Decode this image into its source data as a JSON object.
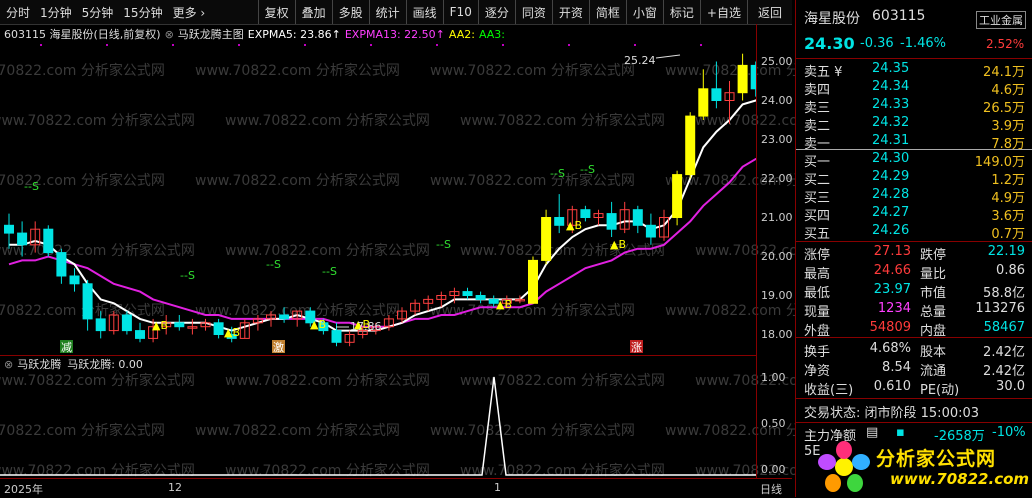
{
  "toolbar": {
    "left": [
      "分时",
      "1分钟",
      "5分钟",
      "15分钟",
      "更多 ›"
    ],
    "right": [
      "复权",
      "叠加",
      "多股",
      "统计",
      "画线",
      "F10",
      "逐分",
      "同资",
      "开资",
      "简框",
      "小窗",
      "标记",
      "+自选",
      "返回"
    ]
  },
  "info": {
    "code_name": "603115 海星股份(日线,前复权)",
    "indicator": "马跃龙腾主图",
    "expma5": "EXPMA5: 23.86↑",
    "expma13": "EXPMA13: 22.50↑",
    "aa2": "AA2:",
    "aa3": "AA3:"
  },
  "y_axis": [
    "25.00",
    "24.00",
    "23.00",
    "22.00",
    "21.00",
    "20.00",
    "19.00",
    "18.00"
  ],
  "sub_y_axis": [
    "1.00",
    "0.50",
    "0.00"
  ],
  "sub_indicator": {
    "name": "马跃龙腾",
    "value": "马跃龙腾: 0.00"
  },
  "x_axis": {
    "year": "2025年",
    "m12": "12",
    "m1": "1",
    "period": "日线"
  },
  "chart_labels": {
    "high": "25.24",
    "low": "17.86",
    "b": "▲B",
    "s": "--S",
    "tag_jian": "减",
    "tag_ji": "激",
    "tag_zhang": "涨"
  },
  "watermark": "www.70822.com 分析家公式网",
  "panel": {
    "name": "海星股份",
    "code": "603115",
    "sector": "工业金属",
    "price": "24.30",
    "change": "-0.36",
    "change_pct": "-1.46%",
    "sector_pct": "2.52%",
    "asks": [
      {
        "label": "卖五 ¥",
        "price": "24.35",
        "vol": "24.1万"
      },
      {
        "label": "卖四",
        "price": "24.34",
        "vol": "4.6万"
      },
      {
        "label": "卖三",
        "price": "24.33",
        "vol": "26.5万"
      },
      {
        "label": "卖二",
        "price": "24.32",
        "vol": "3.9万"
      },
      {
        "label": "卖一",
        "price": "24.31",
        "vol": "7.8万"
      }
    ],
    "bids": [
      {
        "label": "买一",
        "price": "24.30",
        "vol": "149.0万"
      },
      {
        "label": "买二",
        "price": "24.29",
        "vol": "1.2万"
      },
      {
        "label": "买三",
        "price": "24.28",
        "vol": "4.9万"
      },
      {
        "label": "买四",
        "price": "24.27",
        "vol": "3.6万"
      },
      {
        "label": "买五",
        "price": "24.26",
        "vol": "0.7万"
      }
    ],
    "stats": [
      {
        "l1": "涨停",
        "v1": "27.13",
        "l2": "跌停",
        "v2": "22.19"
      },
      {
        "l1": "最高",
        "v1": "24.66",
        "l2": "量比",
        "v2": "0.86"
      },
      {
        "l1": "最低",
        "v1": "23.97",
        "l2": "市值",
        "v2": "58.8亿"
      },
      {
        "l1": "现量",
        "v1": "1234",
        "l2": "总量",
        "v2": "113276"
      },
      {
        "l1": "外盘",
        "v1": "54809",
        "l2": "内盘",
        "v2": "58467"
      }
    ],
    "fin": [
      {
        "l1": "换手",
        "v1": "4.68%",
        "l2": "股本",
        "v2": "2.42亿"
      },
      {
        "l1": "净资",
        "v1": "8.54",
        "l2": "流通",
        "v2": "2.42亿"
      },
      {
        "l1": "收益(三)",
        "v1": "0.610",
        "l2": "PE(动)",
        "v2": "30.0"
      }
    ],
    "trade_status": "交易状态: 闭市阶段 15:00:03",
    "main_net_label": "主力净额",
    "main_net_value": "-2658万",
    "main_net_pct": "-10%",
    "tabs": [
      "5E"
    ],
    "logo_text": "分析家公式网",
    "logo_url": "www.70822.com"
  },
  "chart_data": {
    "type": "candlestick",
    "ylim": [
      17.5,
      25.5
    ],
    "candles": [
      [
        20.8,
        21.1,
        20.2,
        20.6
      ],
      [
        20.6,
        20.9,
        20.0,
        20.3
      ],
      [
        20.3,
        20.9,
        20.1,
        20.7
      ],
      [
        20.7,
        20.8,
        20.0,
        20.1
      ],
      [
        20.1,
        20.2,
        19.3,
        19.5
      ],
      [
        19.5,
        19.7,
        19.1,
        19.3
      ],
      [
        19.3,
        19.4,
        18.1,
        18.4
      ],
      [
        18.4,
        18.6,
        17.9,
        18.1
      ],
      [
        18.1,
        18.6,
        18.0,
        18.5
      ],
      [
        18.5,
        18.6,
        18.0,
        18.1
      ],
      [
        18.1,
        18.3,
        17.8,
        17.9
      ],
      [
        17.9,
        18.4,
        17.8,
        18.2
      ],
      [
        18.2,
        18.5,
        18.0,
        18.3
      ],
      [
        18.3,
        18.5,
        18.1,
        18.2
      ],
      [
        18.2,
        18.4,
        18.0,
        18.2
      ],
      [
        18.2,
        18.4,
        18.1,
        18.3
      ],
      [
        18.3,
        18.4,
        17.9,
        18.0
      ],
      [
        18.0,
        18.2,
        17.8,
        17.9
      ],
      [
        17.9,
        18.4,
        17.9,
        18.3
      ],
      [
        18.3,
        18.5,
        18.1,
        18.4
      ],
      [
        18.4,
        18.6,
        18.2,
        18.5
      ],
      [
        18.5,
        18.7,
        18.3,
        18.4
      ],
      [
        18.4,
        18.6,
        18.2,
        18.6
      ],
      [
        18.6,
        18.7,
        18.2,
        18.3
      ],
      [
        18.3,
        18.4,
        18.0,
        18.1
      ],
      [
        18.1,
        18.3,
        17.7,
        17.8
      ],
      [
        17.8,
        18.1,
        17.7,
        18.0
      ],
      [
        18.0,
        18.2,
        17.9,
        18.1
      ],
      [
        18.1,
        18.3,
        18.0,
        18.2
      ],
      [
        18.2,
        18.5,
        18.1,
        18.4
      ],
      [
        18.4,
        18.7,
        18.3,
        18.6
      ],
      [
        18.6,
        18.9,
        18.5,
        18.8
      ],
      [
        18.8,
        19.0,
        18.6,
        18.9
      ],
      [
        18.9,
        19.1,
        18.7,
        19.0
      ],
      [
        19.0,
        19.2,
        18.8,
        19.1
      ],
      [
        19.1,
        19.2,
        18.9,
        19.0
      ],
      [
        19.0,
        19.1,
        18.8,
        18.9
      ],
      [
        18.9,
        19.0,
        18.7,
        18.8
      ],
      [
        18.8,
        19.0,
        18.7,
        18.9
      ],
      [
        18.9,
        19.0,
        18.8,
        18.9
      ],
      [
        18.8,
        20.0,
        18.8,
        19.9
      ],
      [
        19.9,
        21.2,
        19.8,
        21.0
      ],
      [
        21.0,
        21.6,
        20.6,
        20.8
      ],
      [
        20.8,
        21.3,
        20.6,
        21.2
      ],
      [
        21.2,
        21.3,
        20.9,
        21.0
      ],
      [
        21.0,
        21.2,
        20.8,
        21.1
      ],
      [
        21.1,
        21.4,
        20.5,
        20.7
      ],
      [
        20.7,
        21.4,
        20.6,
        21.2
      ],
      [
        21.2,
        21.3,
        20.6,
        20.8
      ],
      [
        20.8,
        21.1,
        20.3,
        20.5
      ],
      [
        20.5,
        21.2,
        20.4,
        21.0
      ],
      [
        21.0,
        22.2,
        20.8,
        22.1
      ],
      [
        22.1,
        23.7,
        22.0,
        23.6
      ],
      [
        23.6,
        24.8,
        23.5,
        24.3
      ],
      [
        24.3,
        25.0,
        23.8,
        24.0
      ],
      [
        24.0,
        24.5,
        23.4,
        24.2
      ],
      [
        24.2,
        25.2,
        24.0,
        24.9
      ],
      [
        24.9,
        25.0,
        24.1,
        24.3
      ],
      [
        24.3,
        24.7,
        24.0,
        24.6
      ]
    ],
    "expma5": [
      20.3,
      20.3,
      20.4,
      20.3,
      20.0,
      19.8,
      19.3,
      18.9,
      18.8,
      18.6,
      18.4,
      18.3,
      18.3,
      18.3,
      18.3,
      18.3,
      18.2,
      18.1,
      18.2,
      18.3,
      18.4,
      18.4,
      18.5,
      18.4,
      18.3,
      18.1,
      18.1,
      18.1,
      18.1,
      18.2,
      18.3,
      18.5,
      18.6,
      18.7,
      18.9,
      18.9,
      18.9,
      18.9,
      18.9,
      18.9,
      19.2,
      19.8,
      20.2,
      20.5,
      20.7,
      20.8,
      20.8,
      20.9,
      20.9,
      20.7,
      20.8,
      21.2,
      22.0,
      22.8,
      23.2,
      23.5,
      23.9,
      24.0,
      24.2
    ],
    "expma13": [
      19.8,
      19.9,
      19.9,
      20.0,
      19.9,
      19.8,
      19.7,
      19.5,
      19.3,
      19.2,
      19.1,
      18.9,
      18.8,
      18.7,
      18.6,
      18.5,
      18.5,
      18.4,
      18.4,
      18.4,
      18.4,
      18.4,
      18.4,
      18.4,
      18.4,
      18.3,
      18.3,
      18.2,
      18.2,
      18.2,
      18.3,
      18.4,
      18.4,
      18.5,
      18.5,
      18.6,
      18.7,
      18.7,
      18.7,
      18.7,
      18.8,
      19.1,
      19.3,
      19.5,
      19.7,
      19.8,
      19.9,
      20.1,
      20.2,
      20.2,
      20.3,
      20.6,
      20.9,
      21.3,
      21.6,
      21.9,
      22.3,
      22.5,
      22.6
    ]
  }
}
